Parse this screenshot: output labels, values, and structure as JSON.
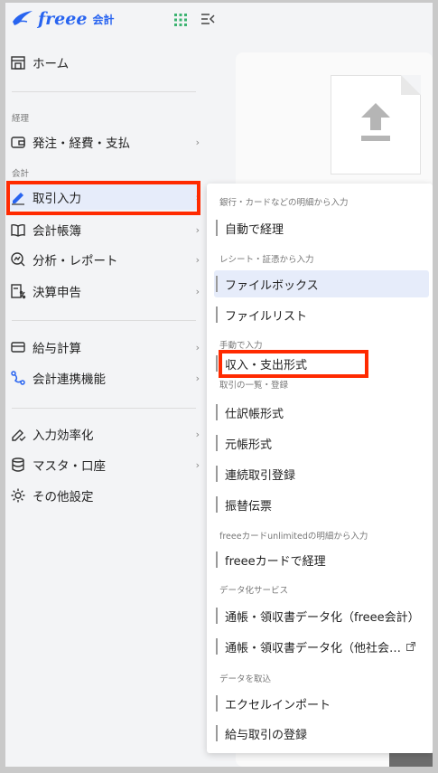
{
  "app": {
    "brand": "freee",
    "product": "会計"
  },
  "sidebar": {
    "sections": {
      "keiri": "経理",
      "kaikei": "会計"
    },
    "items": {
      "home": "ホーム",
      "order_expense": "発注・経費・支払",
      "transaction_input": "取引入力",
      "ledger": "会計帳簿",
      "analysis": "分析・レポート",
      "settlement": "決算申告",
      "payroll": "給与計算",
      "integration": "会計連携機能",
      "efficiency": "入力効率化",
      "master": "マスタ・口座",
      "other_settings": "その他設定"
    }
  },
  "submenu": {
    "groups": {
      "bank": "銀行・カードなどの明細から入力",
      "receipt": "レシート・証憑から入力",
      "manual": "手動で入力",
      "list": "取引の一覧・登録",
      "card": "freeeカードunlimitedの明細から入力",
      "datafy": "データ化サービス",
      "import": "データを取込"
    },
    "items": {
      "auto": "自動で経理",
      "filebox": "ファイルボックス",
      "filelist": "ファイルリスト",
      "income_expense": "収入・支出形式",
      "journal": "仕訳帳形式",
      "ledger_format": "元帳形式",
      "batch": "連続取引登録",
      "transfer": "振替伝票",
      "freee_card": "freeeカードで経理",
      "datafy_freee": "通帳・領収書データ化（freee会計）",
      "datafy_other": "通帳・領収書データ化（他社会…",
      "excel": "エクセルインポート",
      "payroll_tx": "給与取引の登録"
    }
  },
  "colors": {
    "brand": "#2864f0",
    "highlight": "#ff2a00",
    "selected_bg": "#e6ecfa"
  },
  "icons": {
    "logo": "freee-bird-logo-icon",
    "apps": "apps-grid-icon",
    "collapse": "collapse-sidebar-icon",
    "upload": "upload-document-icon"
  }
}
